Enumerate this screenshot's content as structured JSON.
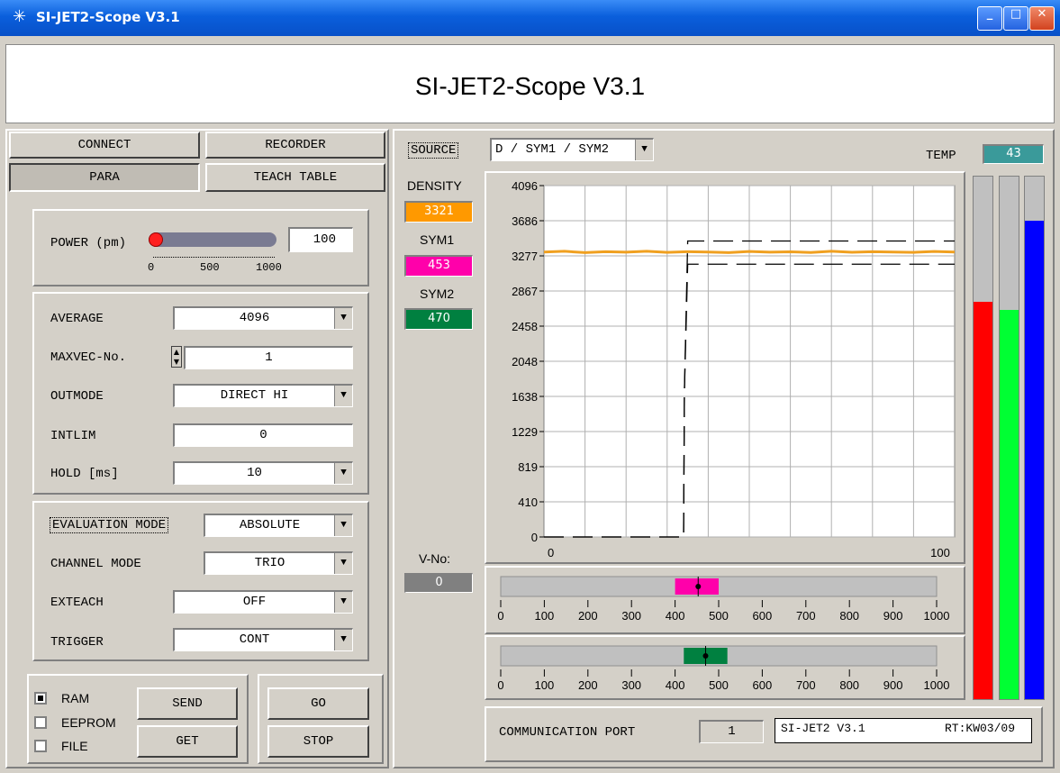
{
  "window": {
    "title": "SI-JET2-Scope V3.1"
  },
  "header": {
    "title": "SI-JET2-Scope V3.1"
  },
  "tabs": {
    "connect": "CONNECT",
    "recorder": "RECORDER",
    "para": "PARA",
    "teach_table": "TEACH TABLE"
  },
  "power": {
    "label": "POWER (pm)",
    "value": "100",
    "level_fraction": 0.0,
    "ticks": [
      "0",
      "500",
      "1000"
    ]
  },
  "params": {
    "average_label": "AVERAGE",
    "average_value": "4096",
    "maxvec_label": "MAXVEC-No.",
    "maxvec_value": "1",
    "outmode_label": "OUTMODE",
    "outmode_value": "DIRECT HI",
    "intlim_label": "INTLIM",
    "intlim_value": "0",
    "hold_label": "HOLD [ms]",
    "hold_value": "10"
  },
  "eval": {
    "evaluation_mode_label": "EVALUATION MODE",
    "evaluation_mode_value": "ABSOLUTE",
    "channel_mode_label": "CHANNEL MODE",
    "channel_mode_value": "TRIO",
    "exteach_label": "EXTEACH",
    "exteach_value": "OFF",
    "trigger_label": "TRIGGER",
    "trigger_value": "CONT"
  },
  "memory": {
    "ram": "RAM",
    "eeprom": "EEPROM",
    "file": "FILE",
    "ram_checked": true,
    "eeprom_checked": false,
    "file_checked": false
  },
  "actions": {
    "send": "SEND",
    "get": "GET",
    "go": "GO",
    "stop": "STOP"
  },
  "source": {
    "label": "SOURCE",
    "value": "D / SYM1 / SYM2"
  },
  "readouts": {
    "density_label": "DENSITY",
    "density_value": "3321",
    "density_color": "#ff9900",
    "sym1_label": "SYM1",
    "sym1_value": "453",
    "sym1_color": "#ff00aa",
    "sym2_label": "SYM2",
    "sym2_value": "470",
    "sym2_color": "#008040",
    "vno_label": "V-No:",
    "vno_value": "0"
  },
  "temp": {
    "label": "TEMP",
    "value": "43"
  },
  "bars": {
    "red_fraction": 0.76,
    "green_fraction": 0.745,
    "blue_fraction": 0.915
  },
  "comm": {
    "label": "COMMUNICATION PORT",
    "port": "1",
    "device": "SI-JET2 V3.1",
    "rt": "RT:KW03/09"
  },
  "chart_data": {
    "type": "line",
    "ylim": [
      0,
      4096
    ],
    "xlim": [
      0,
      100
    ],
    "yticks": [
      "4096",
      "3686",
      "3277",
      "2867",
      "2458",
      "2048",
      "1638",
      "1229",
      "819",
      "410",
      "0"
    ],
    "xticks": [
      "0",
      "100"
    ],
    "series": [
      {
        "color": "#f0a020",
        "style": "solid",
        "x": [
          0,
          5,
          10,
          15,
          20,
          25,
          30,
          35,
          40,
          45,
          50,
          55,
          60,
          65,
          70,
          75,
          80,
          85,
          90,
          95,
          100
        ],
        "y": [
          3321,
          3330,
          3315,
          3325,
          3320,
          3330,
          3318,
          3326,
          3322,
          3315,
          3328,
          3320,
          3324,
          3316,
          3330,
          3319,
          3325,
          3321,
          3318,
          3328,
          3321
        ]
      },
      {
        "color": "#000000",
        "style": "dashed",
        "x": [
          0,
          34,
          34.2,
          35,
          100
        ],
        "y": [
          0,
          0,
          1700,
          3450,
          3450
        ]
      },
      {
        "color": "#000000",
        "style": "dashed",
        "x": [
          0,
          34,
          34.2,
          35,
          100
        ],
        "y": [
          0,
          0,
          1700,
          3180,
          3180
        ]
      }
    ]
  },
  "sym1_scale": {
    "ticks": [
      "0",
      "100",
      "200",
      "300",
      "400",
      "500",
      "600",
      "700",
      "800",
      "900",
      "1000"
    ],
    "marker": 453,
    "range": [
      400,
      500
    ],
    "color": "#ff00aa"
  },
  "sym2_scale": {
    "ticks": [
      "0",
      "100",
      "200",
      "300",
      "400",
      "500",
      "600",
      "700",
      "800",
      "900",
      "1000"
    ],
    "marker": 470,
    "range": [
      420,
      520
    ],
    "color": "#008040"
  }
}
